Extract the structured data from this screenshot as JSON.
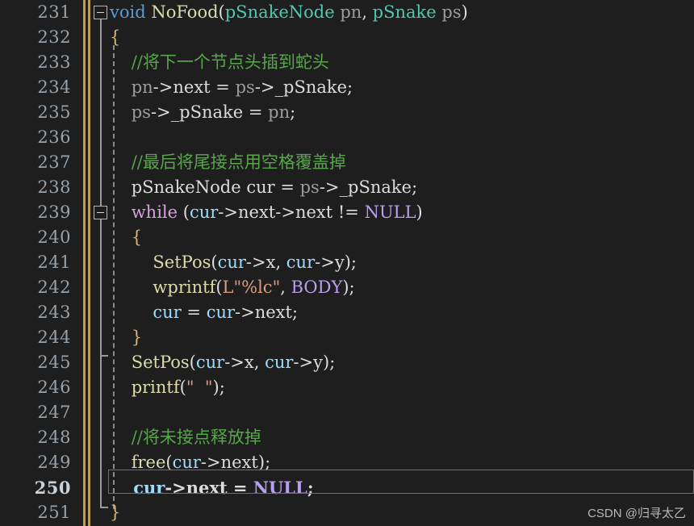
{
  "editor": {
    "theme_background": "#1e1e1e",
    "line_number_color": "#97a2ab",
    "change_bar_color": "#c8a227",
    "current_line": 250,
    "first_line": 231,
    "last_line": 251
  },
  "line_numbers": [
    "231",
    "232",
    "233",
    "234",
    "235",
    "236",
    "237",
    "238",
    "239",
    "240",
    "241",
    "242",
    "243",
    "244",
    "245",
    "246",
    "247",
    "248",
    "249",
    "250",
    "251"
  ],
  "fold": {
    "marker_top_label": "collapse-231",
    "marker_inner_label": "collapse-239"
  },
  "code_lines": [
    {
      "n": "231",
      "tokens": [
        {
          "t": "void",
          "c": "t-kw"
        },
        {
          "t": " ",
          "c": "t-plain"
        },
        {
          "t": "NoFood",
          "c": "t-fn"
        },
        {
          "t": "(",
          "c": "t-paren"
        },
        {
          "t": "pSnakeNode",
          "c": "t-type"
        },
        {
          "t": " ",
          "c": "t-plain"
        },
        {
          "t": "pn",
          "c": "t-param"
        },
        {
          "t": ", ",
          "c": "t-punc"
        },
        {
          "t": "pSnake",
          "c": "t-type"
        },
        {
          "t": " ",
          "c": "t-plain"
        },
        {
          "t": "ps",
          "c": "t-param"
        },
        {
          "t": ")",
          "c": "t-paren"
        }
      ]
    },
    {
      "n": "232",
      "tokens": [
        {
          "t": "{",
          "c": "t-brace"
        }
      ]
    },
    {
      "n": "233",
      "tokens": [
        {
          "t": "    //将下一个节点头插到蛇头",
          "c": "t-cmt"
        }
      ]
    },
    {
      "n": "234",
      "tokens": [
        {
          "t": "    ",
          "c": "t-plain"
        },
        {
          "t": "pn",
          "c": "t-param"
        },
        {
          "t": "->",
          "c": "t-punc"
        },
        {
          "t": "next",
          "c": "t-plain"
        },
        {
          "t": " = ",
          "c": "t-punc"
        },
        {
          "t": "ps",
          "c": "t-param"
        },
        {
          "t": "->",
          "c": "t-punc"
        },
        {
          "t": "_pSnake",
          "c": "t-plain"
        },
        {
          "t": ";",
          "c": "t-punc"
        }
      ]
    },
    {
      "n": "235",
      "tokens": [
        {
          "t": "    ",
          "c": "t-plain"
        },
        {
          "t": "ps",
          "c": "t-param"
        },
        {
          "t": "->",
          "c": "t-punc"
        },
        {
          "t": "_pSnake",
          "c": "t-plain"
        },
        {
          "t": " = ",
          "c": "t-punc"
        },
        {
          "t": "pn",
          "c": "t-param"
        },
        {
          "t": ";",
          "c": "t-punc"
        }
      ]
    },
    {
      "n": "236",
      "tokens": []
    },
    {
      "n": "237",
      "tokens": [
        {
          "t": "    //最后将尾接点用空格覆盖掉",
          "c": "t-cmt"
        }
      ]
    },
    {
      "n": "238",
      "tokens": [
        {
          "t": "    ",
          "c": "t-plain"
        },
        {
          "t": "pSnakeNode",
          "c": "t-plain"
        },
        {
          "t": " ",
          "c": "t-plain"
        },
        {
          "t": "cur",
          "c": "t-plain"
        },
        {
          "t": " = ",
          "c": "t-punc"
        },
        {
          "t": "ps",
          "c": "t-param"
        },
        {
          "t": "->",
          "c": "t-punc"
        },
        {
          "t": "_pSnake",
          "c": "t-plain"
        },
        {
          "t": ";",
          "c": "t-punc"
        }
      ]
    },
    {
      "n": "239",
      "tokens": [
        {
          "t": "    ",
          "c": "t-plain"
        },
        {
          "t": "while",
          "c": "t-ctrl"
        },
        {
          "t": " (",
          "c": "t-paren"
        },
        {
          "t": "cur",
          "c": "t-var"
        },
        {
          "t": "->",
          "c": "t-punc"
        },
        {
          "t": "next",
          "c": "t-plain"
        },
        {
          "t": "->",
          "c": "t-punc"
        },
        {
          "t": "next",
          "c": "t-plain"
        },
        {
          "t": " != ",
          "c": "t-punc"
        },
        {
          "t": "NULL",
          "c": "t-macro"
        },
        {
          "t": ")",
          "c": "t-paren"
        }
      ]
    },
    {
      "n": "240",
      "tokens": [
        {
          "t": "    {",
          "c": "t-brace"
        }
      ]
    },
    {
      "n": "241",
      "tokens": [
        {
          "t": "        ",
          "c": "t-plain"
        },
        {
          "t": "SetPos",
          "c": "t-fn"
        },
        {
          "t": "(",
          "c": "t-paren"
        },
        {
          "t": "cur",
          "c": "t-var"
        },
        {
          "t": "->",
          "c": "t-punc"
        },
        {
          "t": "x",
          "c": "t-plain"
        },
        {
          "t": ", ",
          "c": "t-punc"
        },
        {
          "t": "cur",
          "c": "t-var"
        },
        {
          "t": "->",
          "c": "t-punc"
        },
        {
          "t": "y",
          "c": "t-plain"
        },
        {
          "t": ")",
          "c": "t-paren"
        },
        {
          "t": ";",
          "c": "t-punc"
        }
      ]
    },
    {
      "n": "242",
      "tokens": [
        {
          "t": "        ",
          "c": "t-plain"
        },
        {
          "t": "wprintf",
          "c": "t-fn"
        },
        {
          "t": "(",
          "c": "t-paren"
        },
        {
          "t": "L\"%lc\"",
          "c": "t-str"
        },
        {
          "t": ", ",
          "c": "t-punc"
        },
        {
          "t": "BODY",
          "c": "t-macro"
        },
        {
          "t": ")",
          "c": "t-paren"
        },
        {
          "t": ";",
          "c": "t-punc"
        }
      ]
    },
    {
      "n": "243",
      "tokens": [
        {
          "t": "        ",
          "c": "t-plain"
        },
        {
          "t": "cur",
          "c": "t-var"
        },
        {
          "t": " = ",
          "c": "t-punc"
        },
        {
          "t": "cur",
          "c": "t-var"
        },
        {
          "t": "->",
          "c": "t-punc"
        },
        {
          "t": "next",
          "c": "t-plain"
        },
        {
          "t": ";",
          "c": "t-punc"
        }
      ]
    },
    {
      "n": "244",
      "tokens": [
        {
          "t": "    }",
          "c": "t-brace"
        }
      ]
    },
    {
      "n": "245",
      "tokens": [
        {
          "t": "    ",
          "c": "t-plain"
        },
        {
          "t": "SetPos",
          "c": "t-fn"
        },
        {
          "t": "(",
          "c": "t-paren"
        },
        {
          "t": "cur",
          "c": "t-var"
        },
        {
          "t": "->",
          "c": "t-punc"
        },
        {
          "t": "x",
          "c": "t-plain"
        },
        {
          "t": ", ",
          "c": "t-punc"
        },
        {
          "t": "cur",
          "c": "t-var"
        },
        {
          "t": "->",
          "c": "t-punc"
        },
        {
          "t": "y",
          "c": "t-plain"
        },
        {
          "t": ")",
          "c": "t-paren"
        },
        {
          "t": ";",
          "c": "t-punc"
        }
      ]
    },
    {
      "n": "246",
      "tokens": [
        {
          "t": "    ",
          "c": "t-plain"
        },
        {
          "t": "printf",
          "c": "t-fn"
        },
        {
          "t": "(",
          "c": "t-paren"
        },
        {
          "t": "\"  \"",
          "c": "t-str"
        },
        {
          "t": ")",
          "c": "t-paren"
        },
        {
          "t": ";",
          "c": "t-punc"
        }
      ]
    },
    {
      "n": "247",
      "tokens": []
    },
    {
      "n": "248",
      "tokens": [
        {
          "t": "    //将未接点释放掉",
          "c": "t-cmt"
        }
      ]
    },
    {
      "n": "249",
      "tokens": [
        {
          "t": "    ",
          "c": "t-plain"
        },
        {
          "t": "free",
          "c": "t-fn"
        },
        {
          "t": "(",
          "c": "t-paren"
        },
        {
          "t": "cur",
          "c": "t-var"
        },
        {
          "t": "->",
          "c": "t-punc"
        },
        {
          "t": "next",
          "c": "t-plain"
        },
        {
          "t": ")",
          "c": "t-paren"
        },
        {
          "t": ";",
          "c": "t-punc"
        }
      ]
    },
    {
      "n": "250",
      "bold": true,
      "tokens": [
        {
          "t": "    ",
          "c": "t-plain"
        },
        {
          "t": "cur",
          "c": "t-var"
        },
        {
          "t": "->",
          "c": "t-punc"
        },
        {
          "t": "next",
          "c": "t-plain"
        },
        {
          "t": " = ",
          "c": "t-punc"
        },
        {
          "t": "NULL",
          "c": "t-macro"
        },
        {
          "t": ";",
          "c": "t-punc"
        }
      ]
    },
    {
      "n": "251",
      "tokens": [
        {
          "t": "}",
          "c": "t-brace"
        }
      ]
    }
  ],
  "watermark": {
    "text": "CSDN @归寻太乙"
  }
}
